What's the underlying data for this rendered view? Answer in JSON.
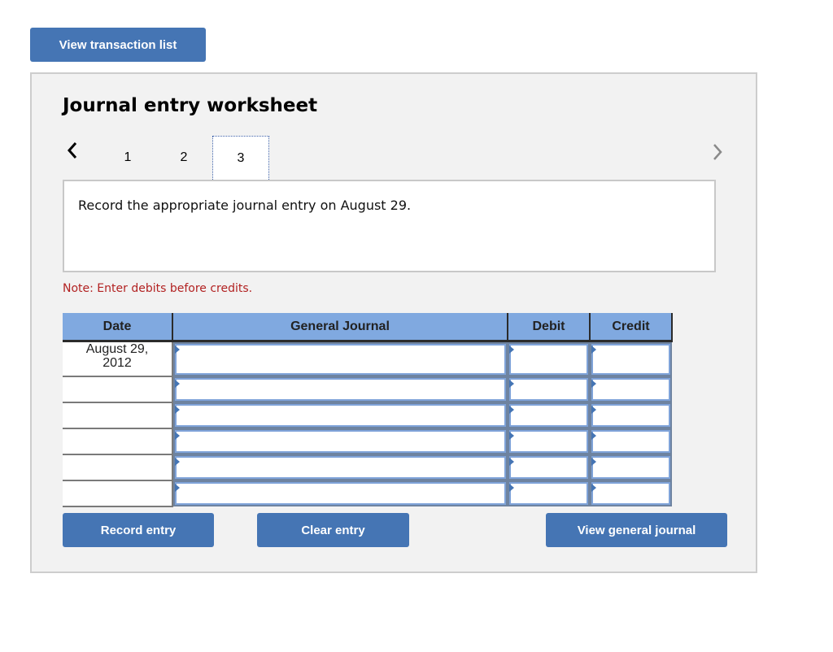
{
  "top_button": {
    "label": "View transaction list"
  },
  "worksheet": {
    "title": "Journal entry worksheet",
    "nav": {
      "prev_icon": "chevron-left-icon",
      "next_icon": "chevron-right-icon",
      "tabs": [
        {
          "label": "1",
          "active": false
        },
        {
          "label": "2",
          "active": false
        },
        {
          "label": "3",
          "active": true
        }
      ]
    },
    "prompt": "Record the appropriate journal entry on August 29.",
    "note": "Note: Enter debits before credits.",
    "table": {
      "columns": [
        "Date",
        "General Journal",
        "Debit",
        "Credit"
      ],
      "rows": [
        {
          "date": "August 29, 2012",
          "account": "",
          "debit": "",
          "credit": ""
        },
        {
          "date": "",
          "account": "",
          "debit": "",
          "credit": ""
        },
        {
          "date": "",
          "account": "",
          "debit": "",
          "credit": ""
        },
        {
          "date": "",
          "account": "",
          "debit": "",
          "credit": ""
        },
        {
          "date": "",
          "account": "",
          "debit": "",
          "credit": ""
        },
        {
          "date": "",
          "account": "",
          "debit": "",
          "credit": ""
        }
      ]
    },
    "buttons": {
      "record": "Record entry",
      "clear": "Clear entry",
      "view_general_journal": "View general journal"
    }
  },
  "colors": {
    "button": "#4575b4",
    "header": "#80a9e0",
    "note": "#b22222",
    "panel": "#f2f2f2"
  }
}
